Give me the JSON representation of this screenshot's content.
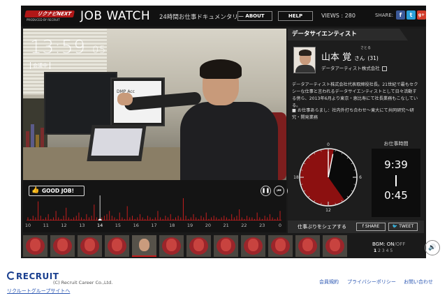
{
  "header": {
    "logo_text": "リクナビNEXT",
    "logo_sub": "PRODUCED BY RECRUIT",
    "title": "JOB WATCH",
    "subtitle": "24時間お仕事ドキュメンタリー",
    "about_label": "ABOUT",
    "help_label": "HELP",
    "views": "VIEWS : 280",
    "share_label": "SHARE:",
    "social": [
      "f",
      "t",
      "g+"
    ]
  },
  "video": {
    "clock_hm": "13:59",
    "clock_sec": "05",
    "status": "会議中",
    "monitor_text": "DMP Acc"
  },
  "timeline": {
    "good_job_label": "GOOD JOB!",
    "controls": [
      "pause",
      "rewind",
      "fullscreen"
    ],
    "hours": [
      "10",
      "11",
      "12",
      "13",
      "14",
      "15",
      "16",
      "17",
      "18",
      "19",
      "20",
      "21",
      "22",
      "23",
      "0"
    ],
    "current_hour": "14"
  },
  "profile": {
    "job_title": "データサイエンティスト",
    "name_ruby": "さとる",
    "name": "山本 覚",
    "honorific": "さん",
    "age": "(31)",
    "company": "データアーティスト株式会社",
    "description": "データアーティスト株式会社代表取締役社長。21世紀で最もセクシーな仕事と言われるデータサイエンティストとして日々活動する傍ら、2013年6月より東京・恵比寿にて社長業務もこなしている。",
    "history": "■ お仕事あらまし：社内外打ち合わせ～東大にて共同研究～研究・開発業務",
    "work_time_label": "お仕事時間",
    "work_start": "9:39",
    "work_end": "0:45",
    "clock_labels": [
      "0",
      "6",
      "12",
      "18"
    ]
  },
  "share_bar": {
    "label": "仕事ぶりをシェアする",
    "facebook": "SHARE",
    "twitter": "TWEET"
  },
  "thumbnails": {
    "count": 12,
    "active_index": 4
  },
  "bgm": {
    "label": "BGM:",
    "on": "ON",
    "slash": "/",
    "off": "OFF",
    "tracks": [
      "1",
      "2",
      "3",
      "4",
      "5"
    ],
    "active_track": "1"
  },
  "footer": {
    "logo": "RECRUIT",
    "copyright": "(C) Recruit Career Co.,Ltd.",
    "group_link": "リクルートグループサイトへ",
    "links": [
      "会員規約",
      "プライバシーポリシー",
      "お問い合わせ"
    ]
  },
  "colors": {
    "accent_red": "#b01717",
    "timeline_red": "#c41e1e",
    "panel_bg": "#1d1d1d"
  },
  "activity": [
    2,
    1,
    3,
    2,
    12,
    3,
    1,
    2,
    4,
    1,
    2,
    6,
    2,
    1,
    3,
    8,
    2,
    1,
    2,
    3,
    5,
    2,
    1,
    4,
    2,
    3,
    10,
    2,
    1,
    2,
    3,
    4,
    6,
    3,
    2,
    1,
    5,
    2,
    1,
    9,
    2,
    3,
    1,
    2,
    4,
    2,
    1,
    3,
    2,
    1,
    2,
    6,
    2,
    1,
    3,
    2,
    4,
    1,
    2,
    3,
    2,
    14,
    3,
    1,
    2,
    4,
    2,
    1,
    3,
    2,
    5,
    1,
    2,
    3,
    2,
    1,
    2,
    3,
    2,
    1,
    4,
    2,
    3,
    7,
    2,
    1,
    3,
    2,
    2,
    1,
    5,
    2,
    1,
    3,
    2,
    4,
    2,
    1,
    2,
    6
  ]
}
